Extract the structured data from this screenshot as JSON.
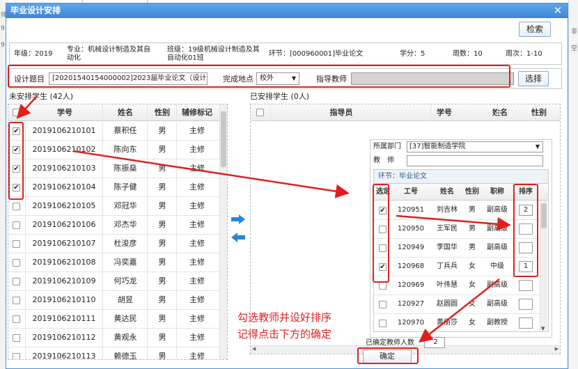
{
  "dialog": {
    "title": "毕业设计安排",
    "search_label": "检索",
    "choose_label": "选择",
    "confirm_label": "确定"
  },
  "info": {
    "grade": "年级：2019",
    "major": "专业：机械设计制造及其自动化",
    "class": "班级：19级机械设计制造及其自动化01班",
    "segment": "环节：[000960001]毕业论文",
    "credit": "学分：5",
    "weeks": "周数：10",
    "week_range": "周次：1-10"
  },
  "config": {
    "topic_label": "设计题目",
    "topic_value": "[20201540154000002]2023届毕业论文（设计）",
    "place_label": "完成地点",
    "place_value": "校外",
    "advisor_label": "指导教师"
  },
  "unassigned": {
    "label": "未安排学生 (42人)",
    "headers": [
      "学号",
      "姓名",
      "性别",
      "辅修标记"
    ],
    "rows": [
      {
        "id": "2019106210101",
        "name": "蔡积任",
        "gender": "男",
        "mark": "主修",
        "checked": true
      },
      {
        "id": "2019106210102",
        "name": "陈向东",
        "gender": "男",
        "mark": "主修",
        "checked": true
      },
      {
        "id": "2019106210103",
        "name": "陈振燊",
        "gender": "男",
        "mark": "主修",
        "checked": true
      },
      {
        "id": "2019106210104",
        "name": "陈子健",
        "gender": "男",
        "mark": "主修",
        "checked": true
      },
      {
        "id": "2019106210105",
        "name": "邓冠华",
        "gender": "男",
        "mark": "主修",
        "checked": false
      },
      {
        "id": "2019106210106",
        "name": "邓杰华",
        "gender": "男",
        "mark": "主修",
        "checked": false
      },
      {
        "id": "2019106210107",
        "name": "杜浚彦",
        "gender": "男",
        "mark": "主修",
        "checked": false
      },
      {
        "id": "2019106210108",
        "name": "冯奕嘉",
        "gender": "男",
        "mark": "主修",
        "checked": false
      },
      {
        "id": "2019106210109",
        "name": "何巧龙",
        "gender": "男",
        "mark": "主修",
        "checked": false
      },
      {
        "id": "2019106210110",
        "name": "胡昱",
        "gender": "男",
        "mark": "主修",
        "checked": false
      },
      {
        "id": "2019106210111",
        "name": "黄达民",
        "gender": "男",
        "mark": "主修",
        "checked": false
      },
      {
        "id": "2019106210112",
        "name": "黄观永",
        "gender": "男",
        "mark": "主修",
        "checked": false
      },
      {
        "id": "2019106210113",
        "name": "赖德玉",
        "gender": "男",
        "mark": "主修",
        "checked": false
      }
    ]
  },
  "assigned": {
    "label": "已安排学生 (0人)",
    "headers": [
      "指导员",
      "学号",
      "姓名",
      "性别"
    ]
  },
  "teachers": {
    "dept_label": "所属部门",
    "dept_value": "[37]智能制造学院",
    "teacher_label": "教　师",
    "segment_label": "环节：毕业论文",
    "headers": [
      "选定",
      "工号",
      "姓名",
      "性别",
      "职称",
      "排序"
    ],
    "rows": [
      {
        "id": "120951",
        "name": "刘吉林",
        "gender": "男",
        "title": "副高级",
        "checked": true,
        "rank": "2"
      },
      {
        "id": "120950",
        "name": "王军民",
        "gender": "男",
        "title": "副高级",
        "checked": false,
        "rank": ""
      },
      {
        "id": "120949",
        "name": "李国华",
        "gender": "男",
        "title": "副高级",
        "checked": false,
        "rank": ""
      },
      {
        "id": "120968",
        "name": "丁兵兵",
        "gender": "女",
        "title": "中级",
        "checked": true,
        "rank": "1"
      },
      {
        "id": "120969",
        "name": "叶伟慧",
        "gender": "女",
        "title": "副高级",
        "checked": false,
        "rank": ""
      },
      {
        "id": "120927",
        "name": "赵圆圆",
        "gender": "女",
        "title": "副高级",
        "checked": false,
        "rank": ""
      },
      {
        "id": "120970",
        "name": "黄丽莎",
        "gender": "女",
        "title": "副教授",
        "checked": false,
        "rank": ""
      }
    ],
    "confirmed_label": "已确定教师人数",
    "confirmed_count": "2"
  },
  "annotation": {
    "line1": "勾选教师并设好排序",
    "line2": "记得点击下方的确定"
  },
  "colors": {
    "title_bar": "#3c86d6",
    "annotation": "#e02020",
    "arrow": "#2b87d1"
  }
}
